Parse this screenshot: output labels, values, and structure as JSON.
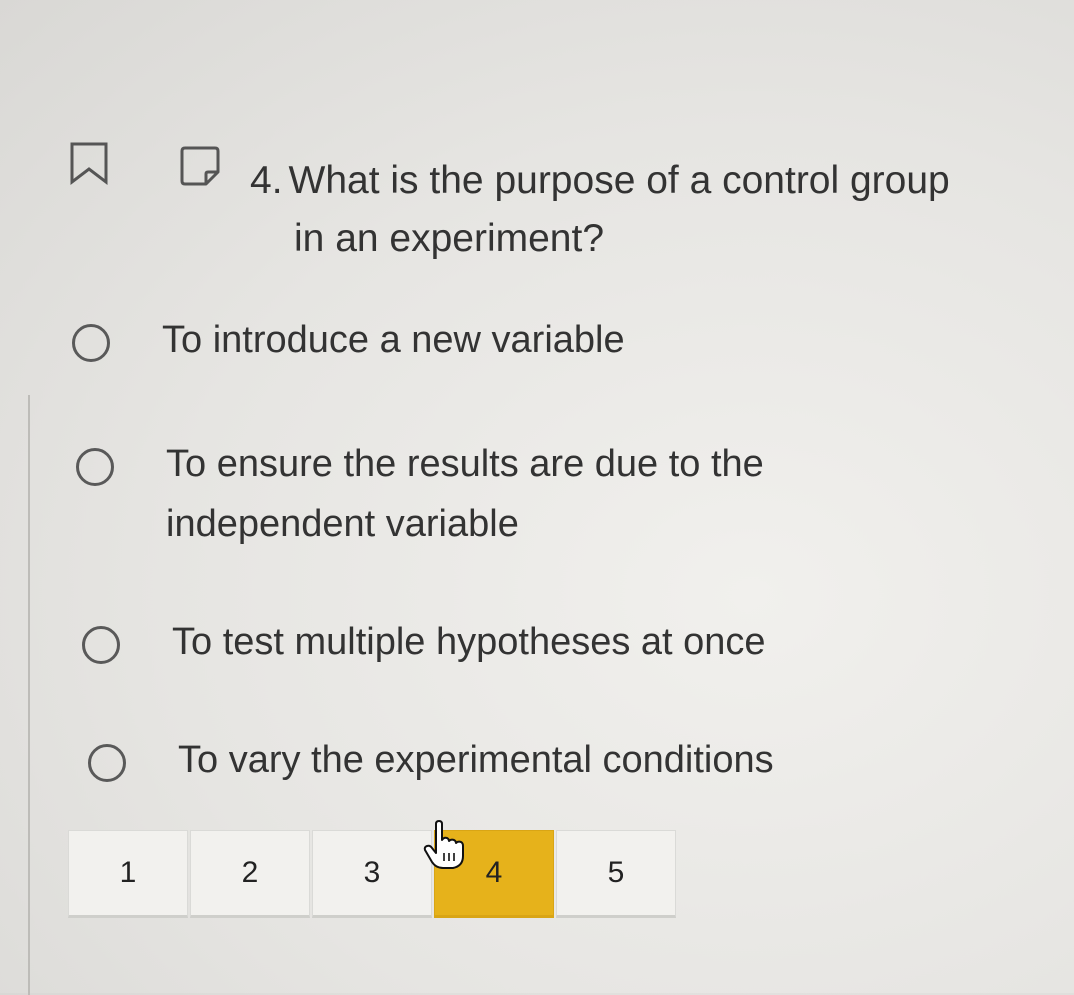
{
  "question": {
    "number": "4.",
    "line1": "What is the purpose of a control group",
    "line2": "in an experiment?"
  },
  "options": [
    {
      "line1": "To introduce a new variable",
      "line2": ""
    },
    {
      "line1": "To ensure the results are due to the",
      "line2": "independent variable"
    },
    {
      "line1": "To test multiple hypotheses at once",
      "line2": ""
    },
    {
      "line1": "To vary the experimental conditions",
      "line2": ""
    }
  ],
  "pager": {
    "pages": [
      "1",
      "2",
      "3",
      "4",
      "5"
    ],
    "current": "4"
  },
  "icons": {
    "bookmark": "bookmark-icon",
    "note": "note-icon",
    "radio": "radio-unchecked-icon",
    "cursor": "hand-pointer-cursor-icon"
  },
  "colors": {
    "active_page": "#e6b21b",
    "radio_border": "#595959",
    "text": "#333333"
  }
}
